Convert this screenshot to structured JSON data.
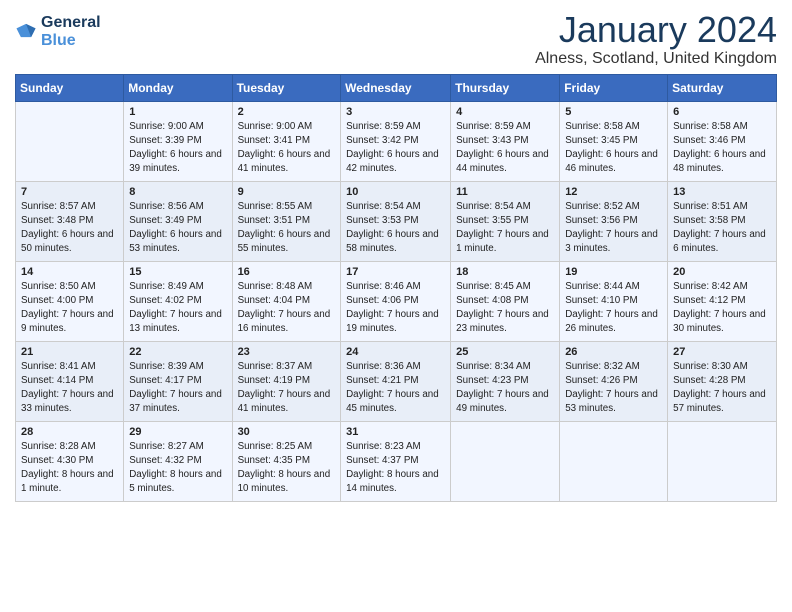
{
  "header": {
    "logo_line1": "General",
    "logo_line2": "Blue",
    "month": "January 2024",
    "location": "Alness, Scotland, United Kingdom"
  },
  "weekdays": [
    "Sunday",
    "Monday",
    "Tuesday",
    "Wednesday",
    "Thursday",
    "Friday",
    "Saturday"
  ],
  "weeks": [
    [
      {
        "day": "",
        "sunrise": "",
        "sunset": "",
        "daylight": ""
      },
      {
        "day": "1",
        "sunrise": "Sunrise: 9:00 AM",
        "sunset": "Sunset: 3:39 PM",
        "daylight": "Daylight: 6 hours and 39 minutes."
      },
      {
        "day": "2",
        "sunrise": "Sunrise: 9:00 AM",
        "sunset": "Sunset: 3:41 PM",
        "daylight": "Daylight: 6 hours and 41 minutes."
      },
      {
        "day": "3",
        "sunrise": "Sunrise: 8:59 AM",
        "sunset": "Sunset: 3:42 PM",
        "daylight": "Daylight: 6 hours and 42 minutes."
      },
      {
        "day": "4",
        "sunrise": "Sunrise: 8:59 AM",
        "sunset": "Sunset: 3:43 PM",
        "daylight": "Daylight: 6 hours and 44 minutes."
      },
      {
        "day": "5",
        "sunrise": "Sunrise: 8:58 AM",
        "sunset": "Sunset: 3:45 PM",
        "daylight": "Daylight: 6 hours and 46 minutes."
      },
      {
        "day": "6",
        "sunrise": "Sunrise: 8:58 AM",
        "sunset": "Sunset: 3:46 PM",
        "daylight": "Daylight: 6 hours and 48 minutes."
      }
    ],
    [
      {
        "day": "7",
        "sunrise": "Sunrise: 8:57 AM",
        "sunset": "Sunset: 3:48 PM",
        "daylight": "Daylight: 6 hours and 50 minutes."
      },
      {
        "day": "8",
        "sunrise": "Sunrise: 8:56 AM",
        "sunset": "Sunset: 3:49 PM",
        "daylight": "Daylight: 6 hours and 53 minutes."
      },
      {
        "day": "9",
        "sunrise": "Sunrise: 8:55 AM",
        "sunset": "Sunset: 3:51 PM",
        "daylight": "Daylight: 6 hours and 55 minutes."
      },
      {
        "day": "10",
        "sunrise": "Sunrise: 8:54 AM",
        "sunset": "Sunset: 3:53 PM",
        "daylight": "Daylight: 6 hours and 58 minutes."
      },
      {
        "day": "11",
        "sunrise": "Sunrise: 8:54 AM",
        "sunset": "Sunset: 3:55 PM",
        "daylight": "Daylight: 7 hours and 1 minute."
      },
      {
        "day": "12",
        "sunrise": "Sunrise: 8:52 AM",
        "sunset": "Sunset: 3:56 PM",
        "daylight": "Daylight: 7 hours and 3 minutes."
      },
      {
        "day": "13",
        "sunrise": "Sunrise: 8:51 AM",
        "sunset": "Sunset: 3:58 PM",
        "daylight": "Daylight: 7 hours and 6 minutes."
      }
    ],
    [
      {
        "day": "14",
        "sunrise": "Sunrise: 8:50 AM",
        "sunset": "Sunset: 4:00 PM",
        "daylight": "Daylight: 7 hours and 9 minutes."
      },
      {
        "day": "15",
        "sunrise": "Sunrise: 8:49 AM",
        "sunset": "Sunset: 4:02 PM",
        "daylight": "Daylight: 7 hours and 13 minutes."
      },
      {
        "day": "16",
        "sunrise": "Sunrise: 8:48 AM",
        "sunset": "Sunset: 4:04 PM",
        "daylight": "Daylight: 7 hours and 16 minutes."
      },
      {
        "day": "17",
        "sunrise": "Sunrise: 8:46 AM",
        "sunset": "Sunset: 4:06 PM",
        "daylight": "Daylight: 7 hours and 19 minutes."
      },
      {
        "day": "18",
        "sunrise": "Sunrise: 8:45 AM",
        "sunset": "Sunset: 4:08 PM",
        "daylight": "Daylight: 7 hours and 23 minutes."
      },
      {
        "day": "19",
        "sunrise": "Sunrise: 8:44 AM",
        "sunset": "Sunset: 4:10 PM",
        "daylight": "Daylight: 7 hours and 26 minutes."
      },
      {
        "day": "20",
        "sunrise": "Sunrise: 8:42 AM",
        "sunset": "Sunset: 4:12 PM",
        "daylight": "Daylight: 7 hours and 30 minutes."
      }
    ],
    [
      {
        "day": "21",
        "sunrise": "Sunrise: 8:41 AM",
        "sunset": "Sunset: 4:14 PM",
        "daylight": "Daylight: 7 hours and 33 minutes."
      },
      {
        "day": "22",
        "sunrise": "Sunrise: 8:39 AM",
        "sunset": "Sunset: 4:17 PM",
        "daylight": "Daylight: 7 hours and 37 minutes."
      },
      {
        "day": "23",
        "sunrise": "Sunrise: 8:37 AM",
        "sunset": "Sunset: 4:19 PM",
        "daylight": "Daylight: 7 hours and 41 minutes."
      },
      {
        "day": "24",
        "sunrise": "Sunrise: 8:36 AM",
        "sunset": "Sunset: 4:21 PM",
        "daylight": "Daylight: 7 hours and 45 minutes."
      },
      {
        "day": "25",
        "sunrise": "Sunrise: 8:34 AM",
        "sunset": "Sunset: 4:23 PM",
        "daylight": "Daylight: 7 hours and 49 minutes."
      },
      {
        "day": "26",
        "sunrise": "Sunrise: 8:32 AM",
        "sunset": "Sunset: 4:26 PM",
        "daylight": "Daylight: 7 hours and 53 minutes."
      },
      {
        "day": "27",
        "sunrise": "Sunrise: 8:30 AM",
        "sunset": "Sunset: 4:28 PM",
        "daylight": "Daylight: 7 hours and 57 minutes."
      }
    ],
    [
      {
        "day": "28",
        "sunrise": "Sunrise: 8:28 AM",
        "sunset": "Sunset: 4:30 PM",
        "daylight": "Daylight: 8 hours and 1 minute."
      },
      {
        "day": "29",
        "sunrise": "Sunrise: 8:27 AM",
        "sunset": "Sunset: 4:32 PM",
        "daylight": "Daylight: 8 hours and 5 minutes."
      },
      {
        "day": "30",
        "sunrise": "Sunrise: 8:25 AM",
        "sunset": "Sunset: 4:35 PM",
        "daylight": "Daylight: 8 hours and 10 minutes."
      },
      {
        "day": "31",
        "sunrise": "Sunrise: 8:23 AM",
        "sunset": "Sunset: 4:37 PM",
        "daylight": "Daylight: 8 hours and 14 minutes."
      },
      {
        "day": "",
        "sunrise": "",
        "sunset": "",
        "daylight": ""
      },
      {
        "day": "",
        "sunrise": "",
        "sunset": "",
        "daylight": ""
      },
      {
        "day": "",
        "sunrise": "",
        "sunset": "",
        "daylight": ""
      }
    ]
  ]
}
